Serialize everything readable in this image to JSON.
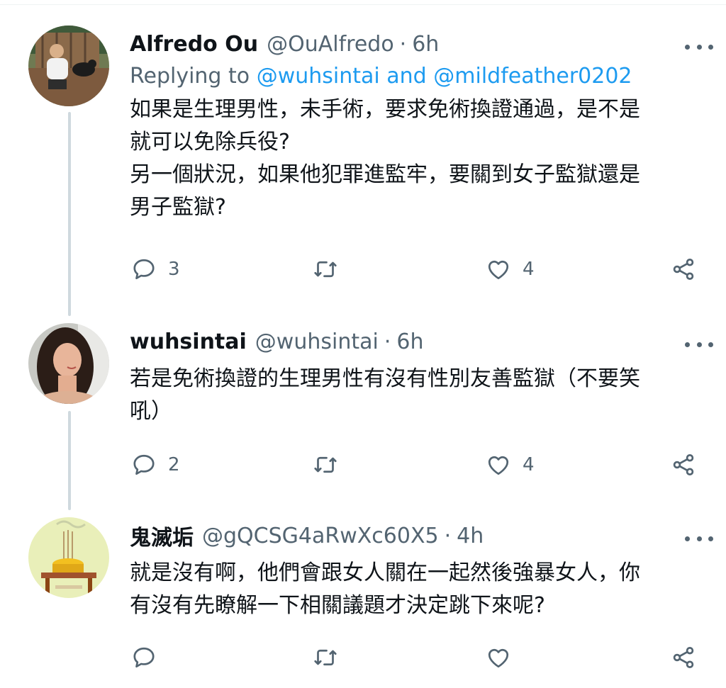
{
  "tweets": [
    {
      "name": "Alfredo Ou",
      "handle": "@OuAlfredo",
      "separator": "·",
      "time": "6h",
      "replying_prefix": "Replying to",
      "replying_user1": "@wuhsintai",
      "replying_and": "and",
      "replying_user2": "@mildfeather0202",
      "lines": [
        "如果是生理男性，未手術，要求免術換證通過，是不是",
        "就可以免除兵役?",
        "另一個狀況，如果他犯罪進監牢，要關到女子監獄還是",
        "男子監獄?"
      ],
      "replies": "3",
      "retweets": "",
      "likes": "4"
    },
    {
      "name": "wuhsintai",
      "handle": "@wuhsintai",
      "separator": "·",
      "time": "6h",
      "lines": [
        "若是免術換證的生理男性有沒有性別友善監獄（不要笑",
        "吼）"
      ],
      "replies": "2",
      "retweets": "",
      "likes": "4"
    },
    {
      "name": "鬼滅垢",
      "handle": "@gQCSG4aRwXc60X5",
      "separator": "·",
      "time": "4h",
      "lines": [
        "就是沒有啊，他們會跟女人關在一起然後強暴女人，你",
        "有沒有先瞭解一下相關議題才決定跳下來呢?"
      ],
      "replies": "",
      "retweets": "",
      "likes": ""
    }
  ],
  "icons": {
    "reply": "reply-icon",
    "retweet": "retweet-icon",
    "like": "heart-icon",
    "share": "share-icon",
    "more": "more-icon"
  },
  "colors": {
    "link": "#1d9bf0",
    "secondary": "#536471",
    "thread_line": "#cfd9de"
  }
}
